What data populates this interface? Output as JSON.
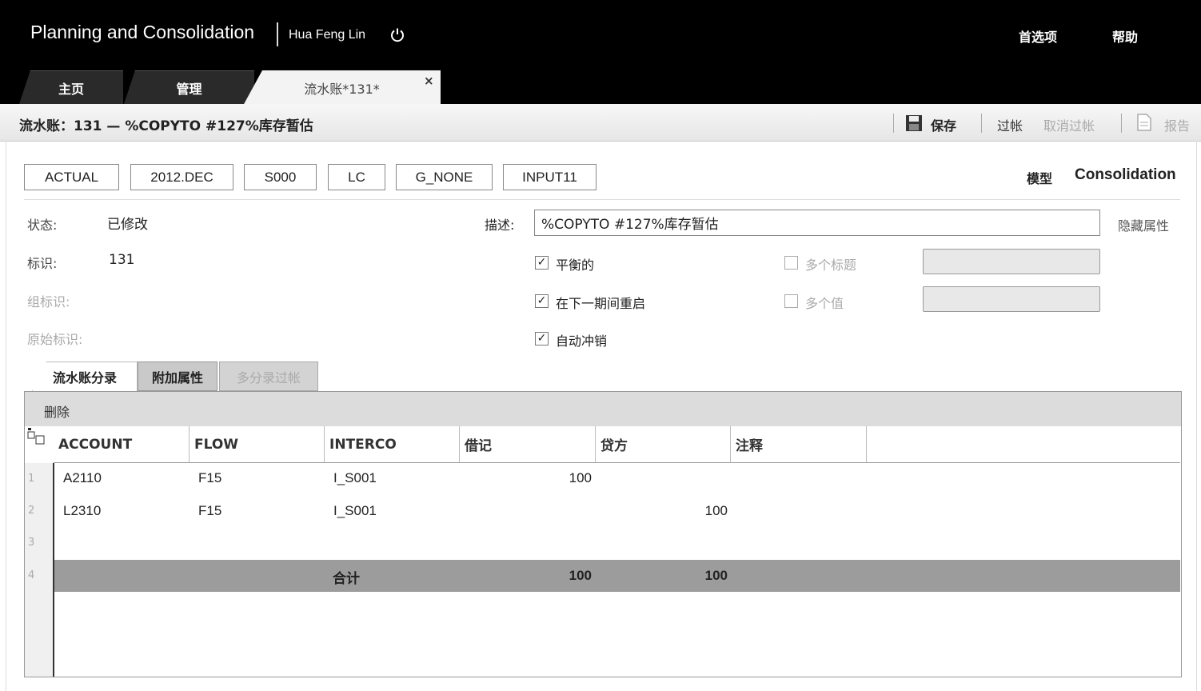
{
  "header": {
    "app_title": "Planning and Consolidation",
    "user": "Hua Feng Lin",
    "preferences": "首选项",
    "help": "帮助"
  },
  "tabs": {
    "home": "主页",
    "manage": "管理",
    "active": "流水账*131*",
    "close": "×"
  },
  "toolbar": {
    "journal_title": "流水账：131 — %COPYTO #127%库存暂估",
    "save": "保存",
    "post": "过帐",
    "unpost": "取消过帐",
    "report": "报告"
  },
  "dimensions": [
    "ACTUAL",
    "2012.DEC",
    "S000",
    "LC",
    "G_NONE",
    "INPUT11"
  ],
  "model": {
    "label": "模型",
    "value": "Consolidation"
  },
  "form": {
    "status_label": "状态:",
    "status_value": "已修改",
    "id_label": "标识:",
    "id_value": "131",
    "group_id_label": "组标识:",
    "original_id_label": "原始标识:",
    "desc_label": "描述:",
    "desc_value": "%COPYTO #127%库存暂估",
    "hide_props": "隐藏属性",
    "cb_balanced": "平衡的",
    "cb_reopen": "在下一期间重启",
    "cb_autoreverse": "自动冲销",
    "cb_multi_header": "多个标题",
    "cb_multi_value": "多个值",
    "check": "✓"
  },
  "subtabs": {
    "entries": "流水账分录",
    "extra": "附加属性",
    "multi": "多分录过帐"
  },
  "grid": {
    "delete": "删除",
    "columns": [
      "ACCOUNT",
      "FLOW",
      "INTERCO",
      "借记",
      "贷方",
      "注释"
    ],
    "row_numbers": [
      "1",
      "2",
      "3",
      "4"
    ],
    "rows": [
      {
        "account": "A2110",
        "flow": "F15",
        "interco": "I_S001",
        "debit": "100",
        "credit": ""
      },
      {
        "account": "L2310",
        "flow": "F15",
        "interco": "I_S001",
        "debit": "",
        "credit": "100"
      }
    ],
    "total": {
      "label": "合计",
      "debit": "100",
      "credit": "100"
    }
  }
}
